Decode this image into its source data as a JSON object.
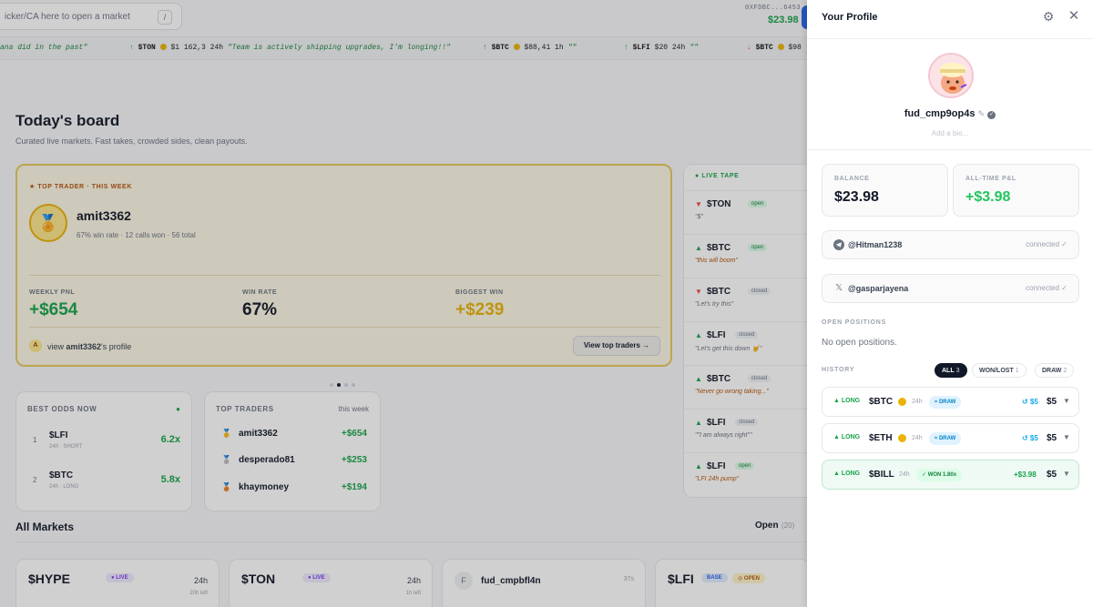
{
  "search": {
    "placeholder": "icker/CA here to open a market",
    "shortcut": "/"
  },
  "wallet": {
    "address": "0XFDBC...6453",
    "balance": "$23.98"
  },
  "ticker": [
    {
      "text_pre": "ana did in the past\"",
      "arrow": "",
      "symbol": "",
      "rest": "",
      "quote": ""
    },
    {
      "arrow": "↑",
      "symbol": "$TON",
      "rest": "$1 162,3  24h",
      "quote": "\"Team is actively shipping upgrades, I'm longing!!\""
    },
    {
      "arrow": "↑",
      "symbol": "$BTC",
      "rest": "$88,41  1h",
      "quote": "\"\""
    },
    {
      "arrow": "↑",
      "symbol": "$LFI",
      "rest": "$20  24h",
      "quote": "\"\""
    },
    {
      "arrow": "↓",
      "symbol": "$BTC",
      "rest": "$98",
      "quote": ""
    }
  ],
  "board": {
    "title": "Today's board",
    "subtitle": "Curated live markets. Fast takes, crowded sides, clean payouts."
  },
  "top_trader": {
    "tag": "★ TOP TRADER · THIS WEEK",
    "name": "amit3362",
    "stats": "67% win rate · 12 calls won · 56 total",
    "weekly_label": "WEEKLY PNL",
    "weekly_value": "+$654",
    "winrate_label": "WIN RATE",
    "winrate_value": "67%",
    "biggest_label": "BIGGEST WIN",
    "biggest_value": "+$239",
    "profile_link_prefix": "view ",
    "profile_link_name": "amit3362",
    "profile_link_suffix": "'s profile",
    "view_button": "View top traders →"
  },
  "best_odds": {
    "title": "BEST ODDS NOW",
    "rows": [
      {
        "rank": "1",
        "symbol": "$LFI",
        "meta": "24h · SHORT",
        "odds": "6.2x"
      },
      {
        "rank": "2",
        "symbol": "$BTC",
        "meta": "24h · LONG",
        "odds": "5.8x"
      }
    ]
  },
  "top_traders": {
    "title": "TOP TRADERS",
    "period": "this week",
    "rows": [
      {
        "name": "amit3362",
        "pnl": "+$654"
      },
      {
        "name": "desperado81",
        "pnl": "+$253"
      },
      {
        "name": "khaymoney",
        "pnl": "+$194"
      }
    ]
  },
  "live_tape": {
    "title": "● LIVE TAPE",
    "items": [
      {
        "dir": "down",
        "symbol": "$TON",
        "status": "open",
        "quote": "\"$\""
      },
      {
        "dir": "up",
        "symbol": "$BTC",
        "status": "open",
        "quote": "\"this will boom\""
      },
      {
        "dir": "down",
        "symbol": "$BTC",
        "status": "closed",
        "quote": "\"Let's try this\""
      },
      {
        "dir": "up",
        "symbol": "$LFI",
        "status": "closed",
        "quote": "\"Let's get this down 🤘\""
      },
      {
        "dir": "up",
        "symbol": "$BTC",
        "status": "closed",
        "quote": "\"Never go wrong taking...\""
      },
      {
        "dir": "up",
        "symbol": "$LFI",
        "status": "closed",
        "quote": "\"\"I am always right\"\""
      },
      {
        "dir": "up",
        "symbol": "$LFI",
        "status": "open",
        "quote": "\"LFI 24h pump\""
      }
    ]
  },
  "all_markets": {
    "title": "All Markets",
    "open_label": "Open",
    "open_count": "(20)",
    "cards": [
      {
        "symbol": "$HYPE",
        "chip": "● LIVE",
        "tf": "24h",
        "left": "20h left"
      },
      {
        "symbol": "$TON",
        "chip": "● LIVE",
        "tf": "24h",
        "left": "1h left"
      },
      {
        "symbol": "fud_cmpbfl4n",
        "chip": "",
        "tf": "37s",
        "left": ""
      },
      {
        "symbol": "$LFI",
        "chip": "BASE",
        "chip2": "◎ OPEN",
        "tf": "",
        "left": ""
      }
    ]
  },
  "profile": {
    "title": "Your Profile",
    "username": "fud_cmp9op4s",
    "bio_placeholder": "Add a bio...",
    "balance_label": "BALANCE",
    "balance_value": "$23.98",
    "pnl_label": "ALL-TIME P&L",
    "pnl_value": "+$3.98",
    "connections": [
      {
        "icon": "telegram-icon",
        "handle": "@Hitman1238",
        "status": "connected ✓"
      },
      {
        "icon": "x-icon",
        "handle": "@gasparjayena",
        "status": "connected ✓"
      }
    ],
    "open_positions_label": "OPEN POSITIONS",
    "open_positions_empty": "No open positions.",
    "history_label": "HISTORY",
    "filters": [
      {
        "label": "ALL",
        "count": "3",
        "active": true
      },
      {
        "label": "WON/LOST",
        "count": "1",
        "active": false
      },
      {
        "label": "DRAW",
        "count": "2",
        "active": false
      }
    ],
    "history": [
      {
        "side": "▲ LONG",
        "symbol": "$BTC",
        "tf": "24h",
        "result": "≈ DRAW",
        "ret": "↺ $5",
        "amount": "$5"
      },
      {
        "side": "▲ LONG",
        "symbol": "$ETH",
        "tf": "24h",
        "result": "≈ DRAW",
        "ret": "↺ $5",
        "amount": "$5"
      },
      {
        "side": "▲ LONG",
        "symbol": "$BILL",
        "tf": "24h",
        "result": "✓ WON 1.80x",
        "ret": "+$3.98",
        "amount": "$5"
      }
    ]
  }
}
